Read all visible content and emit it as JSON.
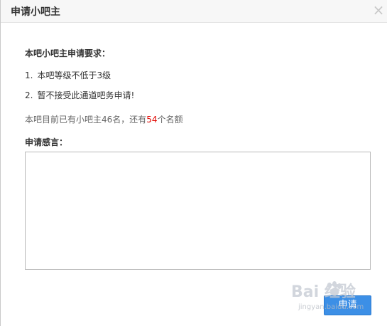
{
  "dialog": {
    "title": "申请小吧主",
    "close_glyph": "×"
  },
  "requirements": {
    "heading": "本吧小吧主申请要求：",
    "items": [
      {
        "num": "1.",
        "text": "本吧等级不低于3级"
      },
      {
        "num": "2.",
        "text": "暂不接受此通道吧务申请!"
      }
    ]
  },
  "quota": {
    "prefix": "本吧目前已有小吧主46名，还有",
    "remaining": "54",
    "suffix": "个名额",
    "highlight_color": "#e10600"
  },
  "statement": {
    "label": "申请感言：",
    "value": ""
  },
  "actions": {
    "submit_label": "申请"
  },
  "watermark": {
    "brand": "Bai 经验",
    "url": "jingyan.baidu.com"
  },
  "icons": [
    "close-icon",
    "baidu-paw-icon"
  ]
}
